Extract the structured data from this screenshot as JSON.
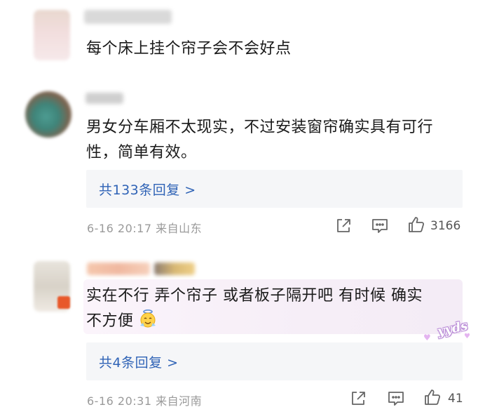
{
  "comments": [
    {
      "text": "每个床上挂个帘子会不会好点"
    },
    {
      "text_line1": "男女分车厢不太现实，不过安装窗帘确实具有可行",
      "text_line2": "性，简单有效。",
      "replies_label": "共133条回复 >",
      "meta": "6-16 20:17 来自山东",
      "like_count": "3166",
      "icons": [
        "share-icon",
        "comment-icon",
        "like-icon"
      ]
    },
    {
      "text_line1": "实在不行  弄个帘子 或者板子隔开吧 有时候 确实",
      "text_line2": "不方便",
      "emoji_name": "angel-emoji",
      "badge": "yyds",
      "replies_label": "共4条回复 >",
      "meta": "6-16 20:31 来自河南",
      "like_count": "41",
      "icons": [
        "share-icon",
        "comment-icon",
        "like-icon"
      ]
    }
  ],
  "colors": {
    "link": "#2f63b6",
    "reply_bg": "#f5f6f8",
    "meta": "#9a9a9a",
    "highlight": "#f6eef7"
  }
}
